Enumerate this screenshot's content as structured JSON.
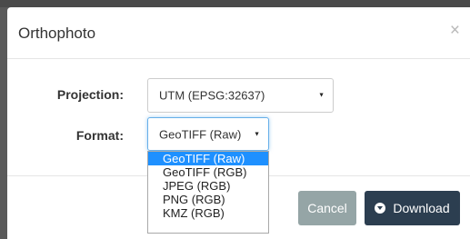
{
  "modal": {
    "title": "Orthophoto",
    "close_label": "×"
  },
  "form": {
    "projection_label": "Projection:",
    "projection_value": "UTM (EPSG:32637)",
    "format_label": "Format:",
    "format_value": "GeoTIFF (Raw)"
  },
  "format_options": [
    {
      "label": "GeoTIFF (Raw)",
      "selected": true
    },
    {
      "label": "GeoTIFF (RGB)",
      "selected": false
    },
    {
      "label": "JPEG (RGB)",
      "selected": false
    },
    {
      "label": "PNG (RGB)",
      "selected": false
    },
    {
      "label": "KMZ (RGB)",
      "selected": false
    }
  ],
  "buttons": {
    "cancel": "Cancel",
    "download": "Download"
  },
  "colors": {
    "cancel_bg": "#95a5a6",
    "download_bg": "#2c3e50",
    "selected_option": "#1e90ff"
  },
  "icons": {
    "download": "download-circle-icon",
    "close": "close-icon",
    "dropdown": "caret-down-icon"
  }
}
